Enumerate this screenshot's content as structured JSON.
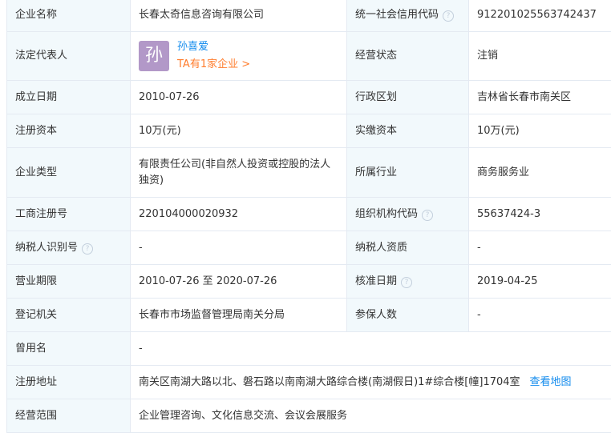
{
  "company_name": {
    "label": "企业名称",
    "value": "长春太奇信息咨询有限公司"
  },
  "credit_code": {
    "label": "统一社会信用代码",
    "value": "912201025563742437"
  },
  "legal_rep": {
    "label": "法定代表人",
    "avatar_char": "孙",
    "name": "孙喜爱",
    "companies": "TA有1家企业 >"
  },
  "status": {
    "label": "经营状态",
    "value": "注销"
  },
  "founded": {
    "label": "成立日期",
    "value": "2010-07-26"
  },
  "region": {
    "label": "行政区划",
    "value": "吉林省长春市南关区"
  },
  "reg_capital": {
    "label": "注册资本",
    "value": "10万(元)"
  },
  "paid_capital": {
    "label": "实缴资本",
    "value": "10万(元)"
  },
  "company_type": {
    "label": "企业类型",
    "value": "有限责任公司(非自然人投资或控股的法人独资)"
  },
  "industry": {
    "label": "所属行业",
    "value": "商务服务业"
  },
  "biz_reg_no": {
    "label": "工商注册号",
    "value": "220104000020932"
  },
  "org_code": {
    "label": "组织机构代码",
    "value": "55637424-3"
  },
  "taxpayer_id": {
    "label": "纳税人识别号",
    "value": "-"
  },
  "taxpayer_qual": {
    "label": "纳税人资质",
    "value": "-"
  },
  "term": {
    "label": "营业期限",
    "value": "2010-07-26 至 2020-07-26"
  },
  "approval_date": {
    "label": "核准日期",
    "value": "2019-04-25"
  },
  "authority": {
    "label": "登记机关",
    "value": "长春市市场监督管理局南关分局"
  },
  "insured": {
    "label": "参保人数",
    "value": "-"
  },
  "former_name": {
    "label": "曾用名",
    "value": "-"
  },
  "address": {
    "label": "注册地址",
    "value": "南关区南湖大路以北、磐石路以南南湖大路综合楼(南湖假日)1#综合楼[幢]1704室",
    "map_link": "查看地图"
  },
  "scope": {
    "label": "经营范围",
    "value": "企业管理咨询、文化信息交流、会议会展服务"
  },
  "help_icon": "?",
  "colors": {
    "label_bg": "#f2f9fc",
    "border": "#e4eaf2",
    "link": "#128bed",
    "accent": "#ff7d2e",
    "avatar_bg": "#b298c8"
  }
}
